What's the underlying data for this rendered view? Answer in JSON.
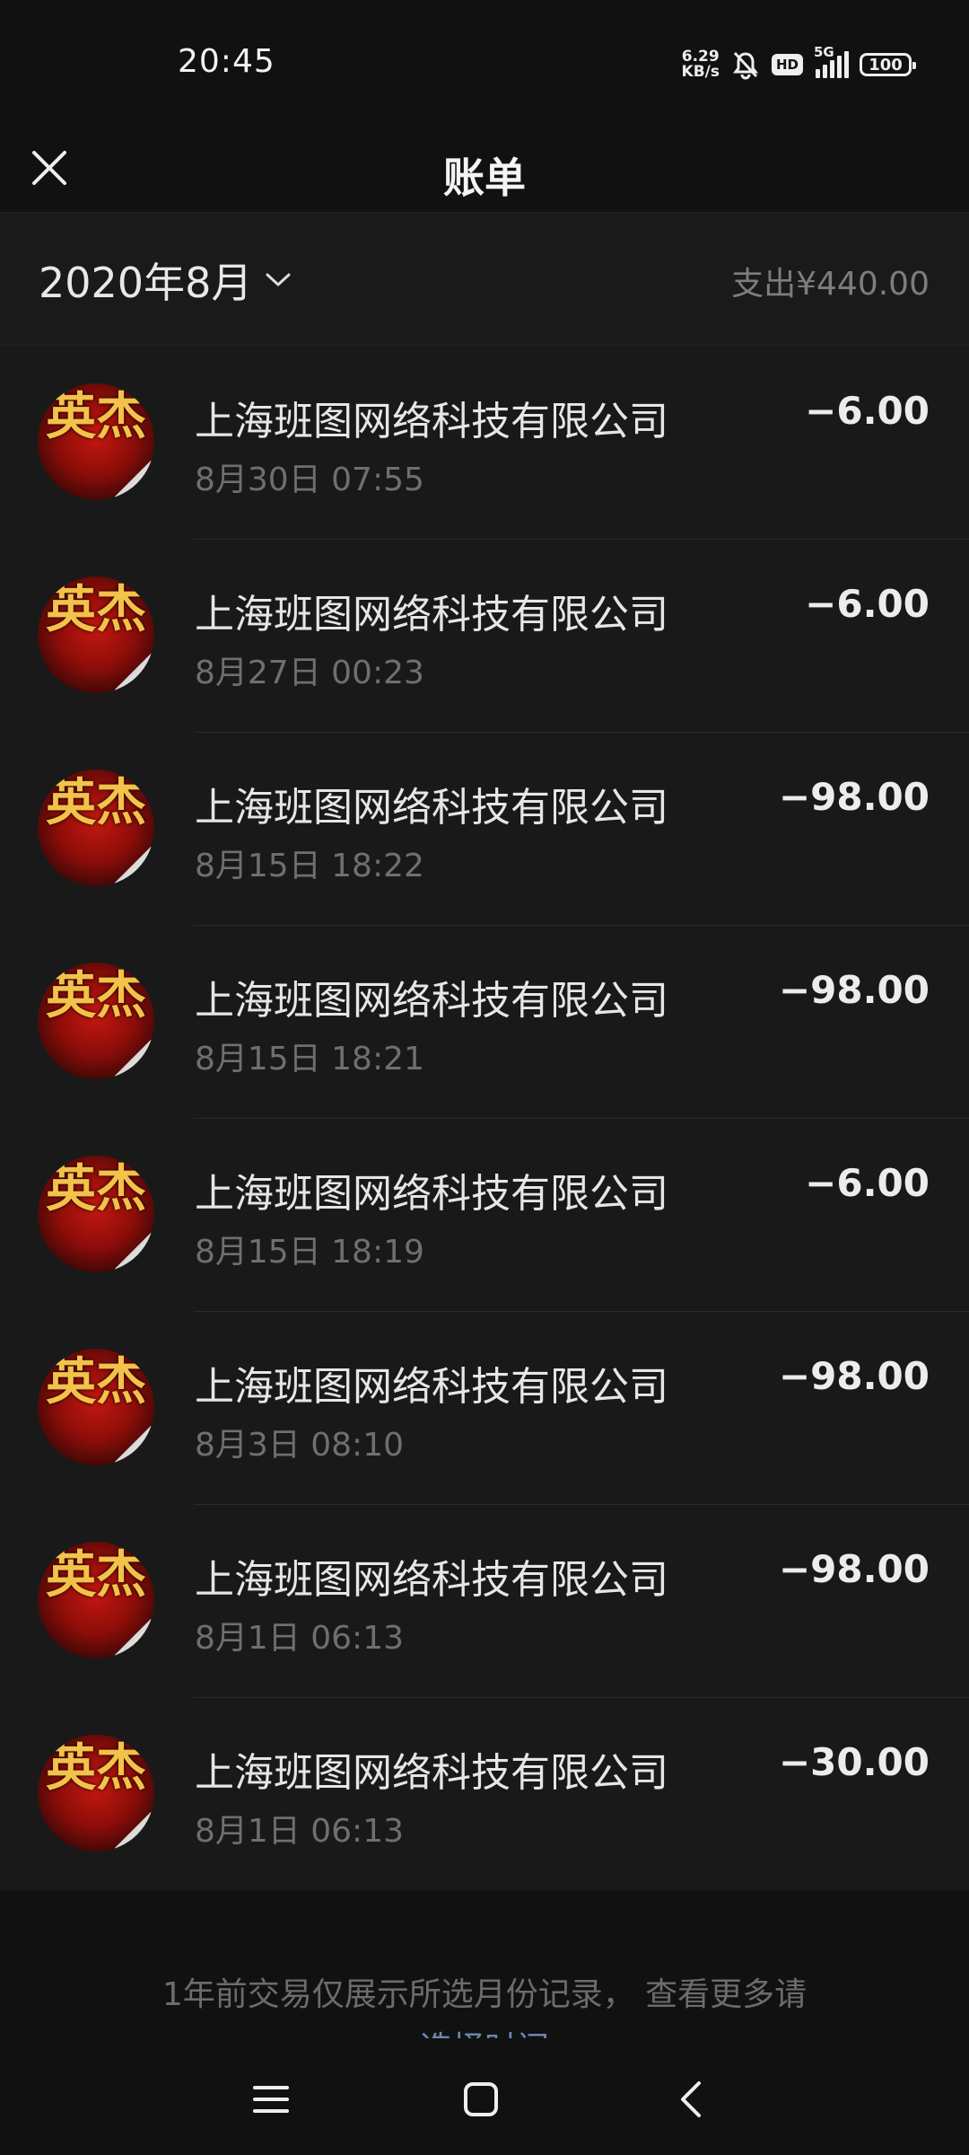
{
  "status_bar": {
    "time": "20:45",
    "net_speed_value": "6.29",
    "net_speed_unit": "KB/s",
    "hd_badge": "HD",
    "network_type": "5G",
    "battery_level": "100"
  },
  "header": {
    "title": "账单"
  },
  "month_bar": {
    "month_label": "2020年8月",
    "total_expense": "支出¥440.00"
  },
  "transactions": [
    {
      "merchant": "上海班图网络科技有限公司",
      "datetime": "8月30日 07:55",
      "amount": "−6.00"
    },
    {
      "merchant": "上海班图网络科技有限公司",
      "datetime": "8月27日 00:23",
      "amount": "−6.00"
    },
    {
      "merchant": "上海班图网络科技有限公司",
      "datetime": "8月15日 18:22",
      "amount": "−98.00"
    },
    {
      "merchant": "上海班图网络科技有限公司",
      "datetime": "8月15日 18:21",
      "amount": "−98.00"
    },
    {
      "merchant": "上海班图网络科技有限公司",
      "datetime": "8月15日 18:19",
      "amount": "−6.00"
    },
    {
      "merchant": "上海班图网络科技有限公司",
      "datetime": "8月3日 08:10",
      "amount": "−98.00"
    },
    {
      "merchant": "上海班图网络科技有限公司",
      "datetime": "8月1日 06:13",
      "amount": "−98.00"
    },
    {
      "merchant": "上海班图网络科技有限公司",
      "datetime": "8月1日 06:13",
      "amount": "−30.00"
    }
  ],
  "footer": {
    "note": "1年前交易仅展示所选月份记录， 查看更多请",
    "link": "选择时间"
  },
  "icons": {
    "close": "close-icon",
    "dropdown": "chevron-down-icon",
    "avatar_glyph": "英杰",
    "nav": [
      "menu-icon",
      "home-icon",
      "back-icon"
    ]
  },
  "colors": {
    "background": "#111111",
    "row_background": "#191919",
    "secondary_text": "#6f6f6f",
    "link": "#6b86ad"
  }
}
